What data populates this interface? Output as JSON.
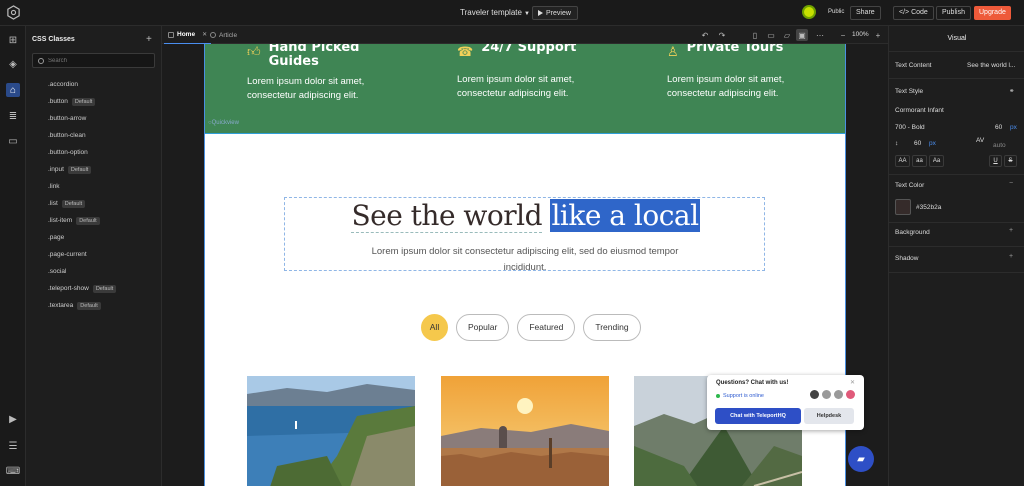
{
  "topbar": {
    "project_title": "Traveler template",
    "preview_label": "Preview",
    "public_label": "Public",
    "share_label": "Share",
    "code_label": "Code",
    "publish_label": "Publish",
    "upgrade_label": "Upgrade"
  },
  "classes_panel": {
    "title": "CSS Classes",
    "search_placeholder": "Search",
    "classes": [
      {
        "name": ".accordion",
        "badge": ""
      },
      {
        "name": ".button",
        "badge": "Default"
      },
      {
        "name": ".button-arrow",
        "badge": ""
      },
      {
        "name": ".button-clean",
        "badge": ""
      },
      {
        "name": ".button-option",
        "badge": ""
      },
      {
        "name": ".input",
        "badge": "Default"
      },
      {
        "name": ".link",
        "badge": ""
      },
      {
        "name": ".list",
        "badge": "Default"
      },
      {
        "name": ".list-item",
        "badge": "Default"
      },
      {
        "name": ".page",
        "badge": ""
      },
      {
        "name": ".page-current",
        "badge": ""
      },
      {
        "name": ".social",
        "badge": ""
      },
      {
        "name": ".teleport-show",
        "badge": "Default"
      },
      {
        "name": ".textarea",
        "badge": "Default"
      }
    ]
  },
  "tabs": [
    {
      "label": "Home"
    },
    {
      "label": "Article"
    }
  ],
  "zoom": "100%",
  "page": {
    "features": [
      {
        "title": "Hand Picked Guides",
        "text": "Lorem ipsum dolor sit amet, consectetur adipiscing elit.",
        "icon": "thumbs-up-icon"
      },
      {
        "title": "24/7 Support",
        "text": "Lorem ipsum dolor sit amet, consectetur adipiscing elit.",
        "icon": "support-icon"
      },
      {
        "title": "Private Tours",
        "text": "Lorem ipsum dolor sit amet, consectetur adipiscing elit.",
        "icon": "user-icon"
      }
    ],
    "quickview_label": "Quickview",
    "hero": {
      "title_plain": "See the world",
      "title_selected": "like a local",
      "subtitle": "Lorem ipsum dolor sit consectetur adipiscing elit, sed do eiusmod tempor incididunt."
    },
    "filters": [
      "All",
      "Popular",
      "Featured",
      "Trending"
    ],
    "active_filter": "All"
  },
  "chat": {
    "question": "Questions? Chat with us!",
    "status": "Support is online",
    "chat_button": "Chat with TeleportHQ",
    "helpdesk_button": "Helpdesk"
  },
  "right_panel": {
    "tab": "Visual",
    "text_content_label": "Text Content",
    "text_content_value": "See the world l...",
    "text_style_label": "Text Style",
    "font_family": "Cormorant Infant",
    "font_weight": "700 - Bold",
    "font_size": "60",
    "font_size_unit": "px",
    "line_height": "60",
    "line_height_unit": "px",
    "letter_spacing": "auto",
    "case_options": [
      "AA",
      "aa",
      "Aa"
    ],
    "text_color_label": "Text Color",
    "text_color_value": "#352b2a",
    "background_label": "Background",
    "shadow_label": "Shadow"
  },
  "colors": {
    "accent": "#4a8ef0",
    "features_bg": "#3f8554",
    "hero_text": "#352b2a",
    "filter_active": "#f5c84c",
    "upgrade": "#ee5a3a",
    "chat_blue": "#2e4fc6"
  }
}
